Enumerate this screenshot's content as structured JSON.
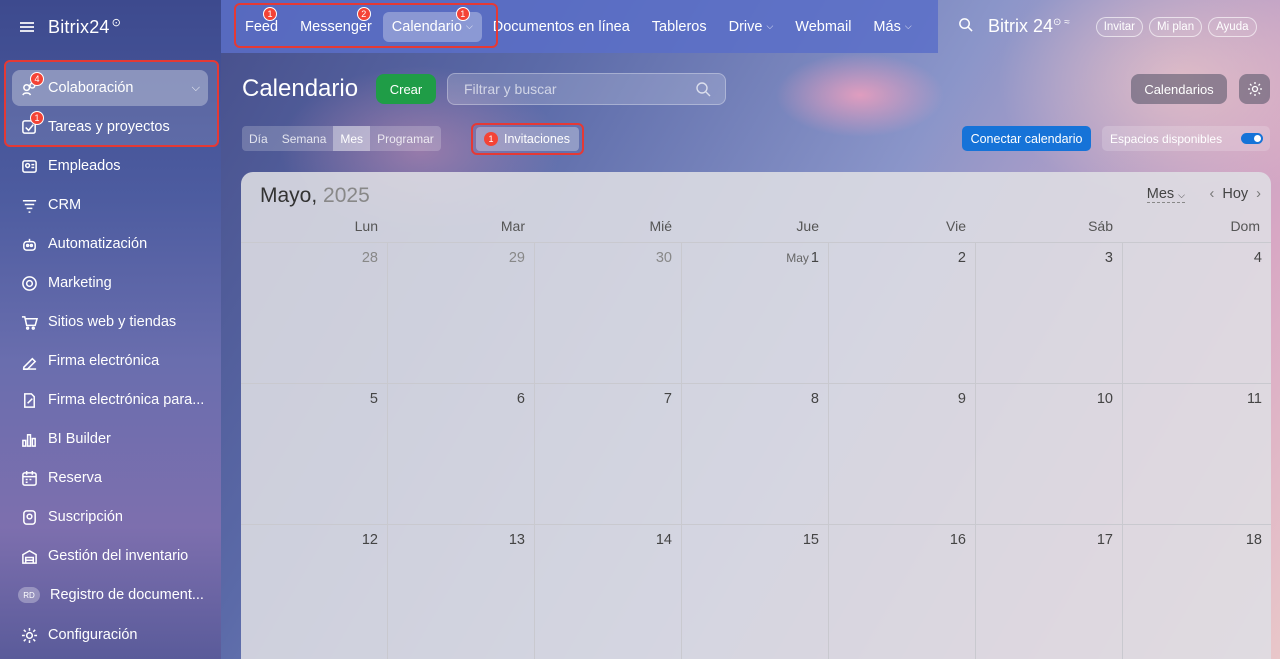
{
  "app": {
    "logo": "Bitrix24",
    "logo_mark": "⊙"
  },
  "topnav": {
    "items": [
      {
        "label": "Feed",
        "badge": "1"
      },
      {
        "label": "Messenger",
        "badge": "2"
      },
      {
        "label": "Calendario",
        "badge": "1",
        "caret": true,
        "selected": true
      },
      {
        "label": "Documentos en línea"
      },
      {
        "label": "Tableros"
      },
      {
        "label": "Drive",
        "caret": true
      },
      {
        "label": "Webmail"
      },
      {
        "label": "Más",
        "caret": true
      }
    ],
    "brand": "Bitrix 24",
    "invite": "Invitar",
    "plan": "Mi plan",
    "help": "Ayuda"
  },
  "sidebar": {
    "items": [
      {
        "label": "Colaboración",
        "badge": "4",
        "icon": "collab-icon"
      },
      {
        "label": "Tareas y proyectos",
        "badge": "1",
        "icon": "tasks-icon"
      },
      {
        "label": "Empleados",
        "icon": "employees-icon"
      },
      {
        "label": "CRM",
        "icon": "crm-icon"
      },
      {
        "label": "Automatización",
        "icon": "automation-icon"
      },
      {
        "label": "Marketing",
        "icon": "marketing-icon"
      },
      {
        "label": "Sitios web y tiendas",
        "icon": "cart-icon"
      },
      {
        "label": "Firma electrónica",
        "icon": "signature-icon"
      },
      {
        "label": "Firma electrónica para...",
        "icon": "sign-doc-icon"
      },
      {
        "label": "BI Builder",
        "icon": "chart-icon"
      },
      {
        "label": "Reserva",
        "icon": "booking-icon"
      },
      {
        "label": "Suscripción",
        "icon": "subscription-icon"
      },
      {
        "label": "Gestión del inventario",
        "icon": "inventory-icon"
      },
      {
        "label": "Registro de document...",
        "icon": "rd-icon",
        "avatar": "RD"
      },
      {
        "label": "Configuración",
        "icon": "gear-icon"
      }
    ]
  },
  "page": {
    "title": "Calendario",
    "create": "Crear",
    "filter_placeholder": "Filtrar y buscar",
    "calendars": "Calendarios",
    "views": [
      "Día",
      "Semana",
      "Mes",
      "Programar"
    ],
    "active_view": "Mes",
    "invitations": "Invitaciones",
    "invitations_badge": "1",
    "connect": "Conectar calendario",
    "spaces": "Espacios disponibles"
  },
  "calendar": {
    "month": "Mayo,",
    "year": "2025",
    "mode": "Mes",
    "today": "Hoy",
    "days": [
      "Lun",
      "Mar",
      "Mié",
      "Jue",
      "Vie",
      "Sáb",
      "Dom"
    ],
    "weeks": [
      [
        {
          "d": "28",
          "o": true
        },
        {
          "d": "29",
          "o": true
        },
        {
          "d": "30",
          "o": true
        },
        {
          "d": "1",
          "pre": "May"
        },
        {
          "d": "2"
        },
        {
          "d": "3"
        },
        {
          "d": "4"
        }
      ],
      [
        {
          "d": "5"
        },
        {
          "d": "6"
        },
        {
          "d": "7"
        },
        {
          "d": "8"
        },
        {
          "d": "9"
        },
        {
          "d": "10"
        },
        {
          "d": "11"
        }
      ],
      [
        {
          "d": "12"
        },
        {
          "d": "13"
        },
        {
          "d": "14"
        },
        {
          "d": "15"
        },
        {
          "d": "16"
        },
        {
          "d": "17"
        },
        {
          "d": "18"
        }
      ]
    ]
  }
}
